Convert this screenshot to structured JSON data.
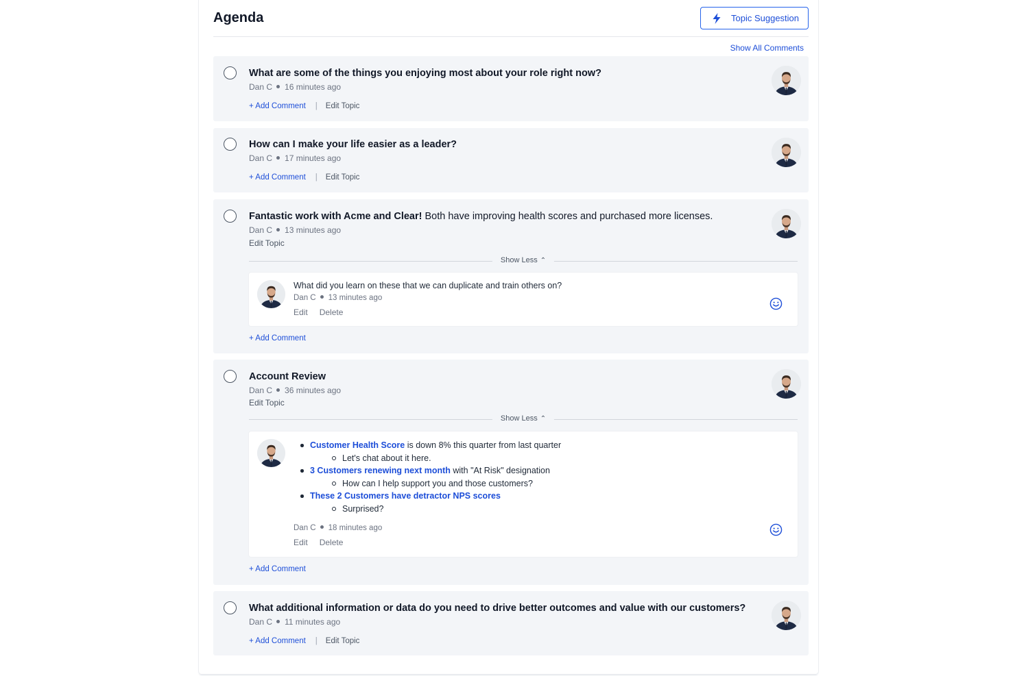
{
  "header": {
    "title": "Agenda",
    "suggest_label": "Topic Suggestion",
    "show_all_label": "Show All Comments"
  },
  "common": {
    "add_comment": "+ Add Comment",
    "separator": "|",
    "edit_topic": "Edit Topic",
    "show_less": "Show Less",
    "edit": "Edit",
    "delete": "Delete"
  },
  "topics": [
    {
      "bold": "What are some of the things you enjoying most about your role right now?",
      "rest": "",
      "author": "Dan C",
      "time": "16 minutes ago"
    },
    {
      "bold": "How can I make your life easier as a leader?",
      "rest": "",
      "author": "Dan C",
      "time": "17 minutes ago"
    },
    {
      "bold": "Fantastic work with Acme and Clear!",
      "rest": " Both have improving health scores and purchased more licenses.",
      "author": "Dan C",
      "time": "13 minutes ago",
      "comment": {
        "text": "What did you learn on these that we can duplicate and train others on?",
        "author": "Dan C",
        "time": "13 minutes ago"
      }
    },
    {
      "bold": "Account Review",
      "rest": "",
      "author": "Dan C",
      "time": "36 minutes ago",
      "comment": {
        "bullets": [
          {
            "link": "Customer Health Score",
            "text": " is down 8% this quarter from last quarter",
            "sub": "Let's chat about it here."
          },
          {
            "link": "3 Customers renewing next month",
            "text": " with \"At Risk\" designation",
            "sub": "How can I help support you and those customers?"
          },
          {
            "link": "These 2 Customers have detractor NPS scores",
            "text": "",
            "sub": "Surprised?"
          }
        ],
        "author": "Dan C",
        "time": "18 minutes ago"
      }
    },
    {
      "bold": "What additional information or data do you need to drive better outcomes and value with our customers?",
      "rest": "",
      "author": "Dan C",
      "time": "11 minutes ago"
    }
  ],
  "colors": {
    "accent": "#1d4ed8",
    "card_bg": "#f3f5f8"
  },
  "icons": {
    "suggest": "lightning-bolt-icon",
    "emoji": "smiley-icon",
    "collapse": "chevron-up-icon"
  }
}
